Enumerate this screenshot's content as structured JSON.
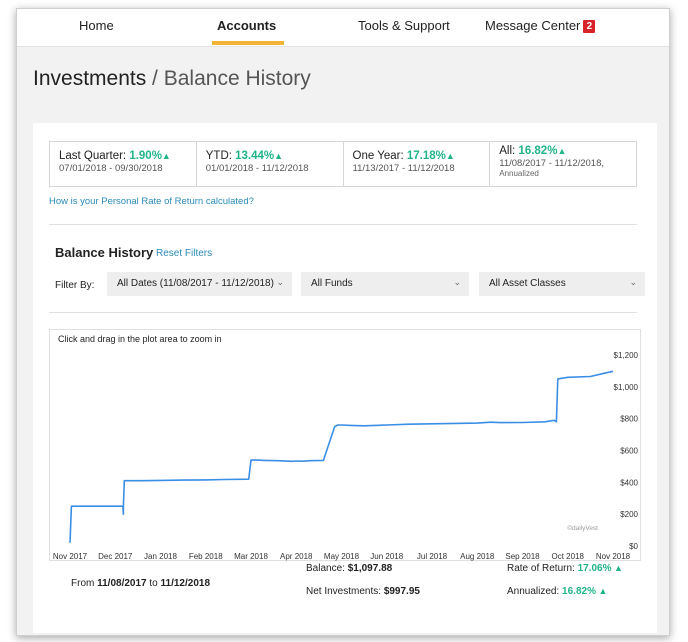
{
  "nav": {
    "home": "Home",
    "accounts": "Accounts",
    "tools": "Tools & Support",
    "messages": "Message Center",
    "message_count": "2"
  },
  "page": {
    "title_main": "Investments",
    "title_sep": " / ",
    "title_sub": "Balance History"
  },
  "rates": [
    {
      "label": "Last Quarter: ",
      "value": "1.90%",
      "dates": "07/01/2018 - 09/30/2018"
    },
    {
      "label": "YTD: ",
      "value": "13.44%",
      "dates": "01/01/2018 - 11/12/2018"
    },
    {
      "label": "One Year: ",
      "value": "17.18%",
      "dates": "11/13/2017 - 11/12/2018"
    },
    {
      "label": "All: ",
      "value": "16.82%",
      "dates": "11/08/2017 - 11/12/2018,",
      "note": "Annualized"
    }
  ],
  "ror_link": "How is your Personal Rate of Return calculated?",
  "balance_history": {
    "title": "Balance History",
    "reset": "Reset Filters",
    "filter_by": "Filter By:",
    "filters": [
      "All Dates (11/08/2017 - 11/12/2018)",
      "All Funds",
      "All Asset Classes"
    ]
  },
  "chart_hint": "Click and drag in the plot area to zoom in",
  "chart_credit": "©dailyVest",
  "chart_data": {
    "type": "line",
    "x_labels": [
      "Nov 2017",
      "Dec 2017",
      "Jan 2018",
      "Feb 2018",
      "Mar 2018",
      "Apr 2018",
      "May 2018",
      "Jun 2018",
      "Jul 2018",
      "Aug 2018",
      "Sep 2018",
      "Oct 2018",
      "Nov 2018"
    ],
    "y_ticks": [
      "$0",
      "$200",
      "$400",
      "$600",
      "$800",
      "$1,000",
      "$1,200"
    ],
    "ylim": [
      0,
      1200
    ],
    "series": [
      {
        "x": [
          0,
          0.03,
          0.5,
          1.17,
          1.18,
          1.18,
          1.2,
          1.6,
          2.0,
          2.5,
          3.0,
          3.4,
          3.95,
          4.0,
          4.15,
          4.3,
          4.6,
          4.9,
          5.0,
          5.15,
          5.3,
          5.6,
          5.85,
          5.92,
          6.0,
          6.2,
          6.5,
          7.0,
          7.5,
          8.0,
          8.5,
          9.0,
          9.3,
          9.5,
          10.0,
          10.5,
          10.7,
          10.75,
          10.78,
          11.0,
          11.5,
          11.8,
          12.0
        ],
        "y": [
          20,
          250,
          250,
          250,
          200,
          250,
          410,
          410,
          412,
          414,
          415,
          418,
          420,
          540,
          540,
          538,
          536,
          532,
          534,
          533,
          536,
          538,
          750,
          760,
          760,
          758,
          755,
          760,
          765,
          768,
          770,
          772,
          778,
          775,
          776,
          780,
          790,
          780,
          1050,
          1060,
          1065,
          1085,
          1097.88
        ]
      }
    ],
    "color": "#3a8ee6",
    "grid": false
  },
  "summary": {
    "from_prefix": "From ",
    "from_date": "11/08/2017",
    "to_word": " to ",
    "to_date": "11/12/2018",
    "balance_label": "Balance: ",
    "balance_value": "$1,097.88",
    "net_label": "Net Investments: ",
    "net_value": "$997.95",
    "ror_label": "Rate of Return: ",
    "ror_value": "17.06%",
    "ann_label": "Annualized: ",
    "ann_value": "16.82%"
  },
  "colors": {
    "accent_green": "#21b38a",
    "link_blue": "#2a8ab8",
    "nav_underline": "#f2b233",
    "badge_red": "#d8232a"
  }
}
